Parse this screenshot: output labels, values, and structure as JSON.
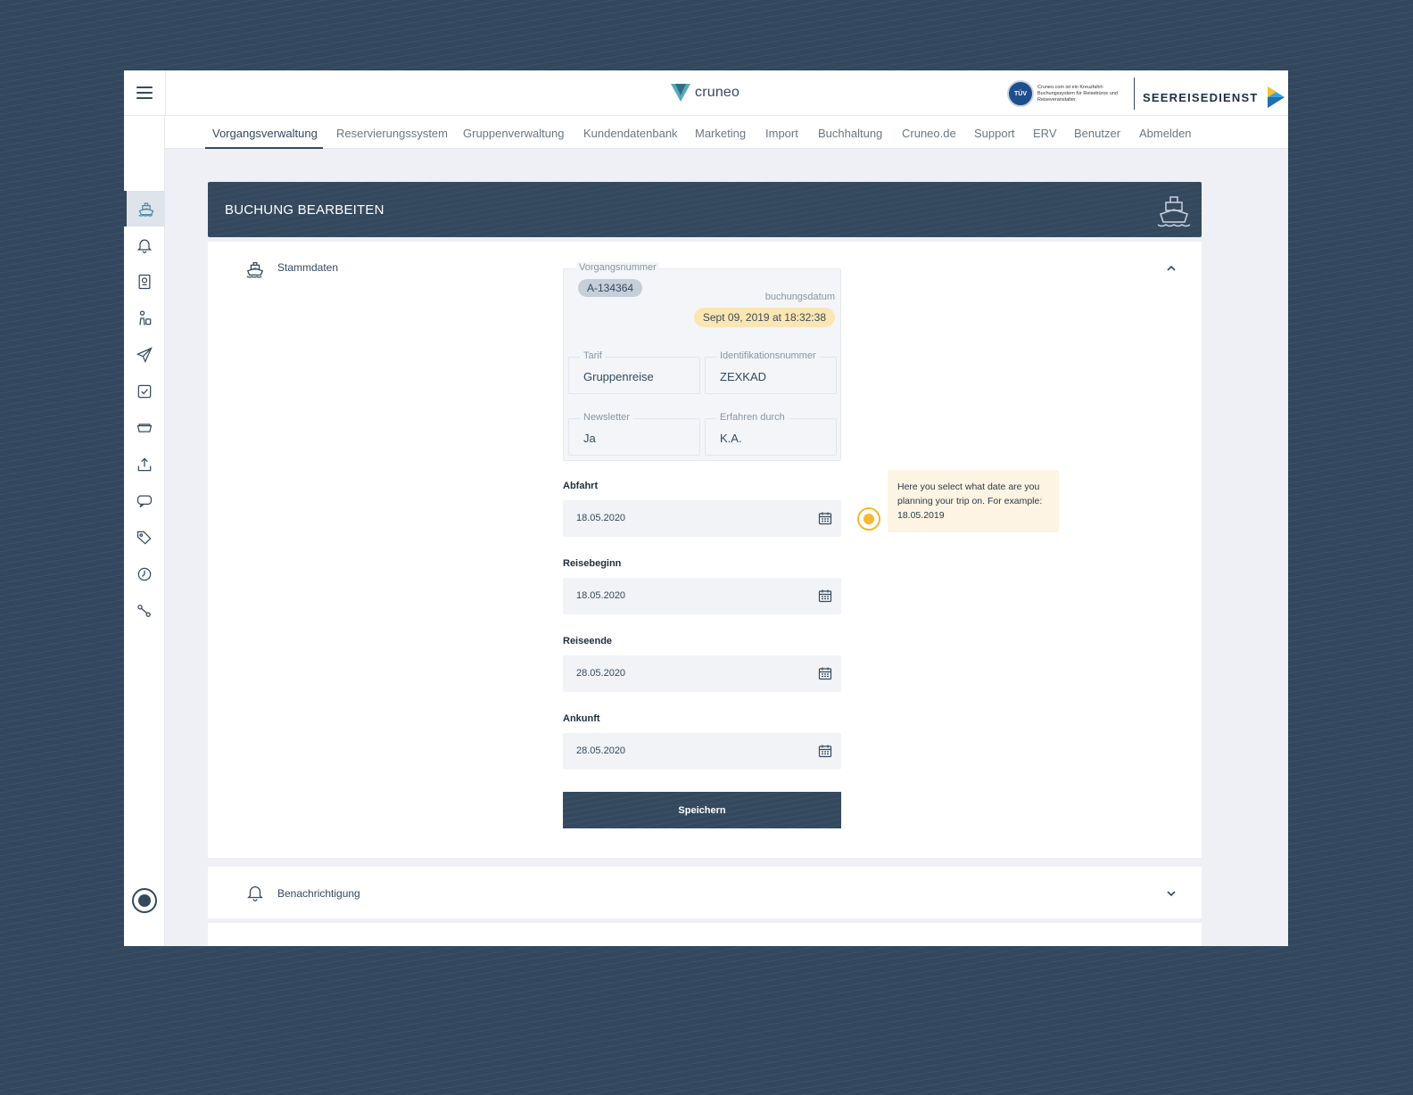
{
  "app": {
    "logo_text": "cruneo",
    "tuv_badge": "TÜV",
    "tuv_text": "Cruneo.com ist ein Kreuzfahrt-Buchungssystem für Reisebüros und Reiseveranstalter.",
    "partner_name": "SEEREISEDIENST"
  },
  "nav": {
    "items": [
      {
        "label": "Vorgangsverwaltung"
      },
      {
        "label": "Reservierungssystem"
      },
      {
        "label": "Gruppenverwaltung"
      },
      {
        "label": "Kundendatenbank"
      },
      {
        "label": "Marketing"
      },
      {
        "label": "Import"
      },
      {
        "label": "Buchhaltung"
      },
      {
        "label": "Cruneo.de"
      },
      {
        "label": "Support"
      },
      {
        "label": "ERV"
      },
      {
        "label": "Benutzer"
      },
      {
        "label": "Abmelden"
      }
    ],
    "active_index": 0
  },
  "sidebar": {
    "icons": [
      "ship-icon",
      "bell-icon",
      "passport-icon",
      "person-luggage-icon",
      "paper-plane-icon",
      "checkbox-icon",
      "boat-icon",
      "upload-icon",
      "chat-icon",
      "tags-icon",
      "history-icon",
      "wrench-icon"
    ]
  },
  "page": {
    "title": "BUCHUNG BEARBEITEN"
  },
  "stammdaten": {
    "label": "Stammdaten",
    "vorgangsnummer_label": "Vorgangsnummer",
    "vorgangsnummer": "A-134364",
    "buchungsdatum_label": "buchungsdatum",
    "buchungsdatum": "Sept 09, 2019 at 18:32:38",
    "tarif_label": "Tarif",
    "tarif": "Gruppenreise",
    "ident_label": "Identifikationsnummer",
    "ident": "ZEXKAD",
    "newsletter_label": "Newsletter",
    "newsletter": "Ja",
    "erfahren_label": "Erfahren durch",
    "erfahren": "K.A."
  },
  "dates": {
    "abfahrt_label": "Abfahrt",
    "abfahrt": "18.05.2020",
    "reisebeginn_label": "Reisebeginn",
    "reisebeginn": "18.05.2020",
    "reiseende_label": "Reiseende",
    "reiseende": "28.05.2020",
    "ankunft_label": "Ankunft",
    "ankunft": "28.05.2020"
  },
  "save_label": "Speichern",
  "tooltip": "Here you select what date are you planning your trip on. For example: 18.05.2019",
  "benachrichtigung_label": "Benachrichtigung",
  "colors": {
    "primary": "#34495e",
    "accent": "#f5b82e",
    "badge_date": "#fbe6b3",
    "badge_number": "#c4cfda"
  }
}
